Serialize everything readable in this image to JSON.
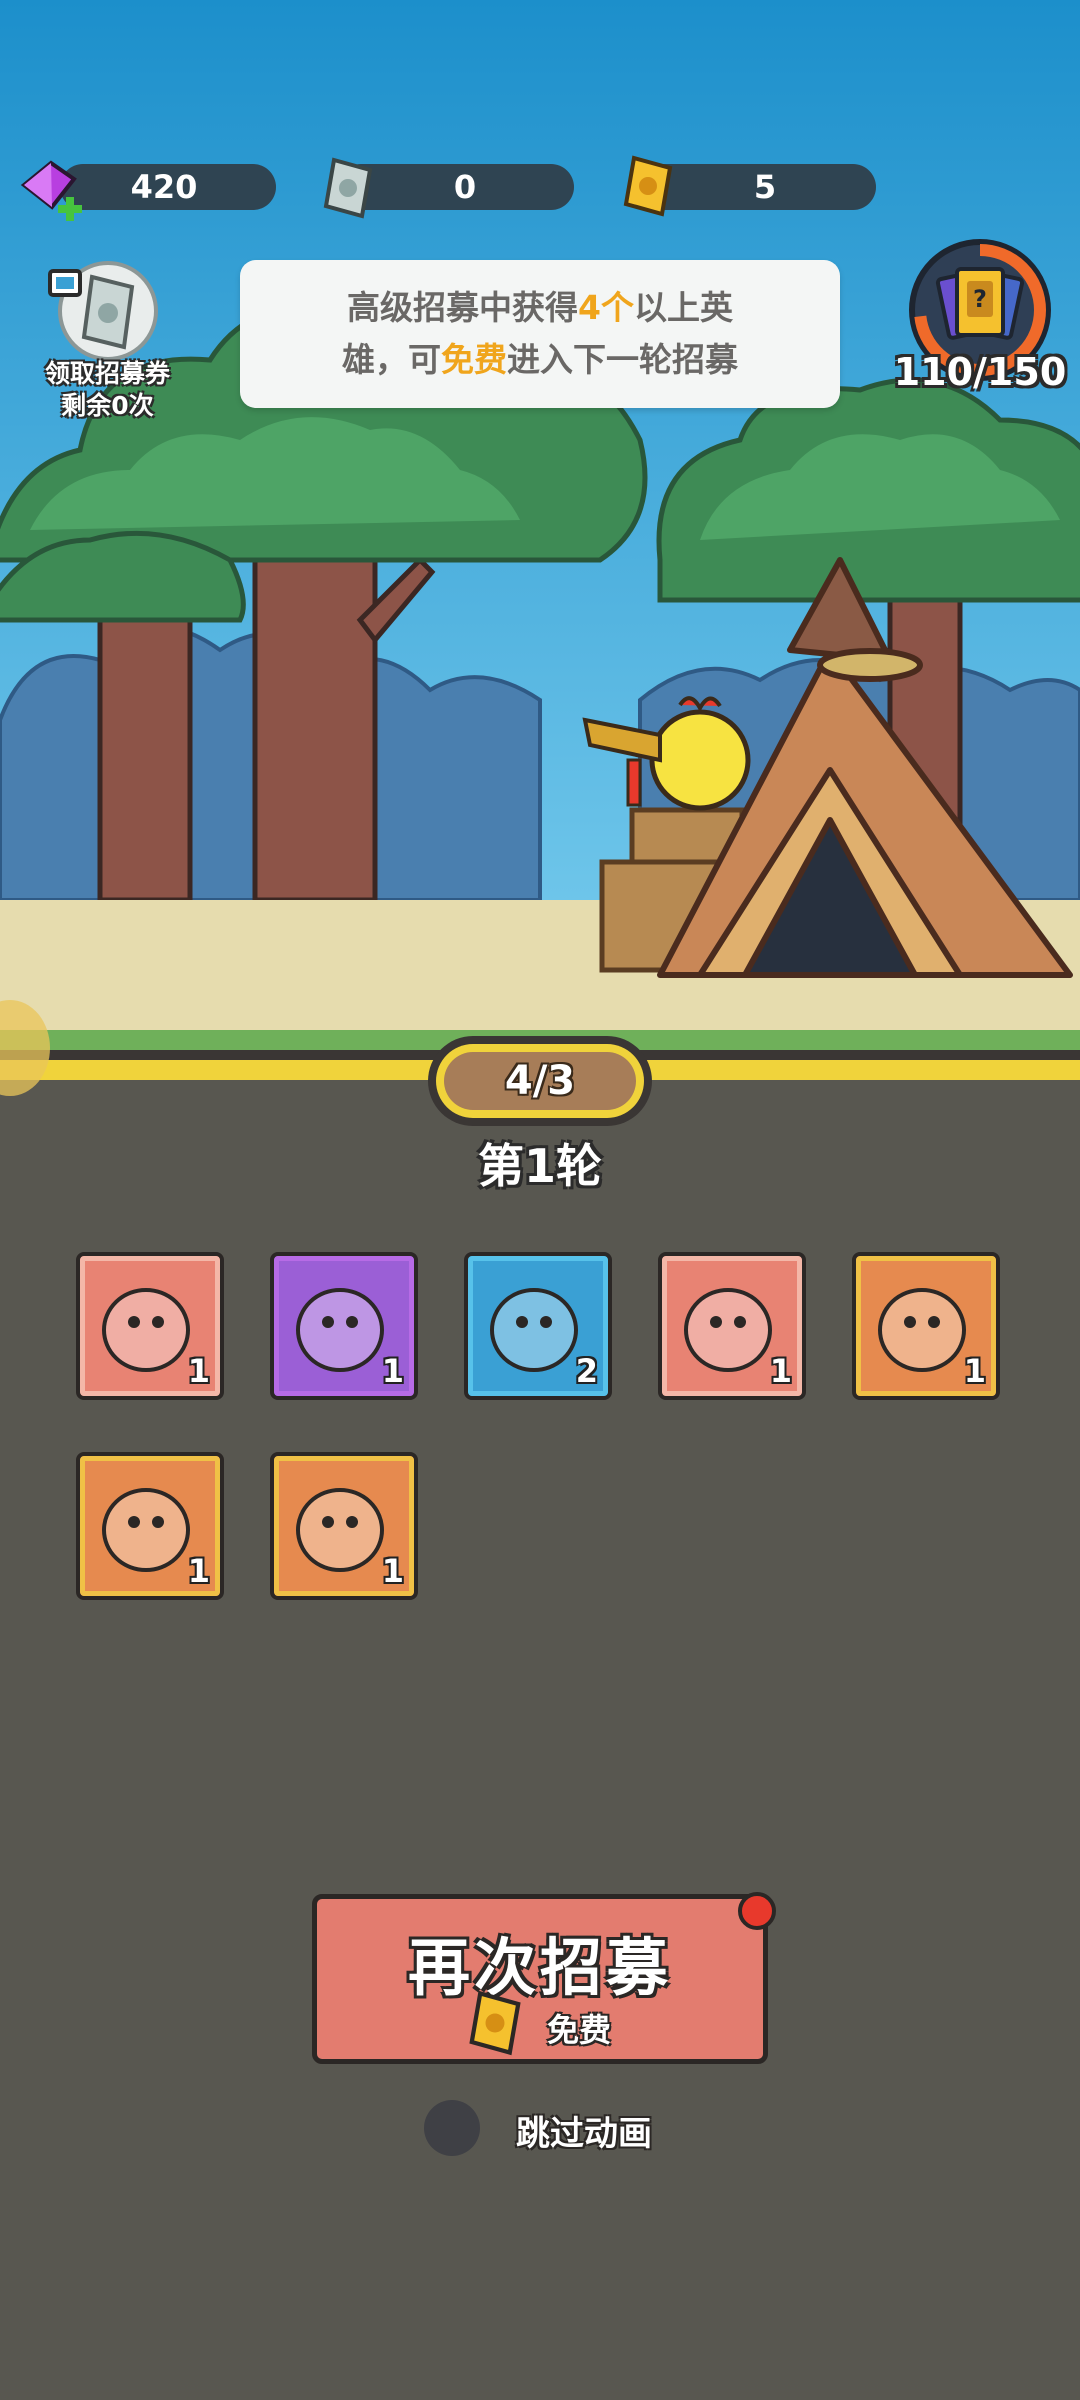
{
  "currencies": {
    "gems": "420",
    "silver_tickets": "0",
    "gold_tickets": "5"
  },
  "coupon": {
    "label_line1": "领取招募券",
    "label_line2": "剩余0次"
  },
  "notice": {
    "seg1": "高级招募中获得",
    "seg2": "4个",
    "seg3": "以上英",
    "seg4": "雄，可",
    "seg5": "免费",
    "seg6": "进入下一轮招募"
  },
  "collection": {
    "progress_text": "110/150",
    "progress_fraction": 0.733
  },
  "round": {
    "progress_text": "4/3",
    "label": "第1轮"
  },
  "heroes": [
    {
      "name": "goggle-cat",
      "count": "1",
      "rarity": "epic"
    },
    {
      "name": "red-lion",
      "count": "1",
      "rarity": "legendary"
    },
    {
      "name": "puzzle-hero",
      "count": "2",
      "rarity": "rare"
    },
    {
      "name": "purple-dragon",
      "count": "1",
      "rarity": "epic"
    },
    {
      "name": "puzzle-crow",
      "count": "1",
      "rarity": "mythic"
    },
    {
      "name": "puzzle-frog",
      "count": "1",
      "rarity": "mythic"
    },
    {
      "name": "puzzle-dizzy",
      "count": "1",
      "rarity": "mythic"
    }
  ],
  "recruit": {
    "title": "再次招募",
    "cost": "免费"
  },
  "skip": {
    "label": "跳过动画"
  },
  "colors": {
    "epic": "#e88373",
    "legendary": "#a44dd6",
    "rare": "#3aa0d4",
    "mythic": "#e3a646",
    "sky": "#2a9fd4",
    "ground": "#e6dcae",
    "panel": "#585750",
    "accent_yellow": "#f0d33b"
  }
}
